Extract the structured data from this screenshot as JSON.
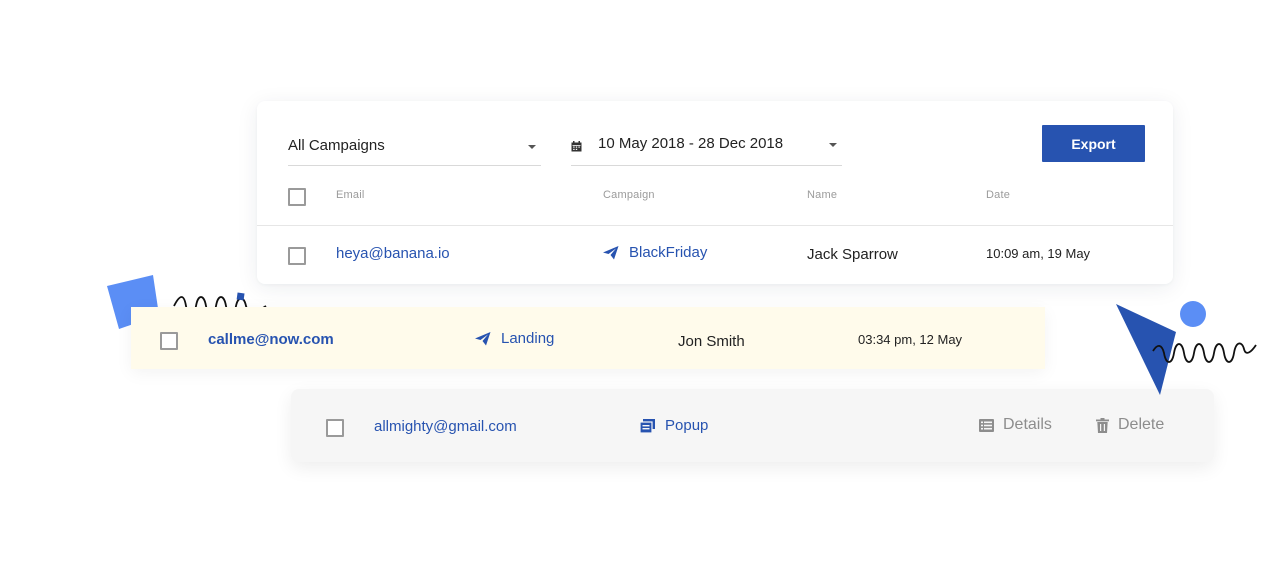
{
  "filters": {
    "campaign_select": "All Campaigns",
    "date_range": "10 May 2018 - 28 Dec 2018",
    "export_label": "Export"
  },
  "table": {
    "columns": [
      "Email",
      "Campaign",
      "Name",
      "Date"
    ],
    "rows": [
      {
        "email": "heya@banana.io",
        "campaign": "BlackFriday",
        "campaign_icon": "paper-plane-icon",
        "name": "Jack Sparrow",
        "date": "10:09 am, 19 May"
      },
      {
        "email": "callme@now.com",
        "campaign": "Landing",
        "campaign_icon": "paper-plane-icon",
        "name": "Jon Smith",
        "date": "03:34 pm, 12 May"
      },
      {
        "email": "allmighty@gmail.com",
        "campaign": "Popup",
        "campaign_icon": "popup-icon"
      }
    ]
  },
  "row_actions": {
    "details_label": "Details",
    "delete_label": "Delete"
  },
  "colors": {
    "accent": "#2753b0",
    "highlight_row": "#fffbeb",
    "hover_row": "#f6f6f6",
    "decor_light_blue": "#5b8ef5",
    "decor_dark_blue": "#2753b0"
  }
}
